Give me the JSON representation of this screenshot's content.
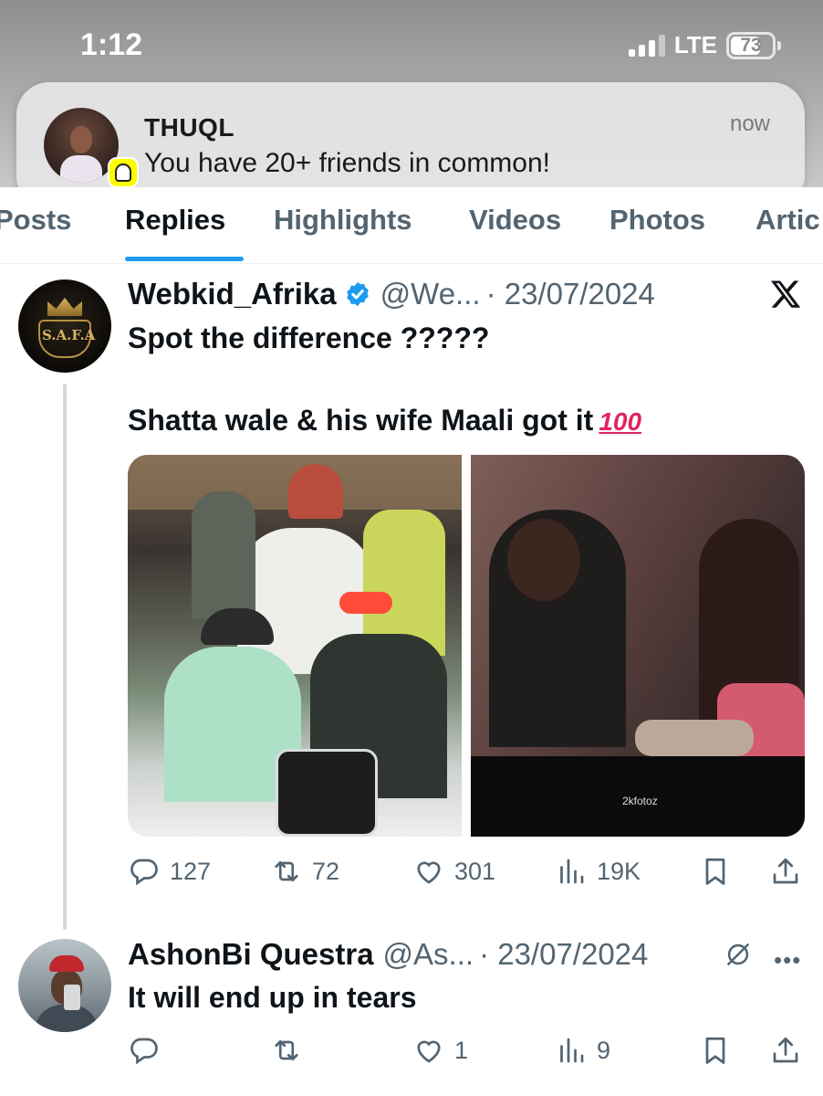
{
  "status_bar": {
    "time": "1:12",
    "network": "LTE",
    "battery_percent": "73",
    "battery_level": 0.73
  },
  "notification": {
    "app": "Snapchat",
    "title": "THUQL",
    "body": "You have 20+ friends in common!",
    "time": "now"
  },
  "tabs": [
    {
      "label": "Posts",
      "active": false
    },
    {
      "label": "Replies",
      "active": true
    },
    {
      "label": "Highlights",
      "active": false
    },
    {
      "label": "Videos",
      "active": false
    },
    {
      "label": "Photos",
      "active": false
    },
    {
      "label": "Artic",
      "active": false
    }
  ],
  "tweets": [
    {
      "name": "Webkid_Afrika",
      "verified": true,
      "handle": "@We...",
      "date": "· 23/07/2024",
      "avatar_text": "S.A.F.A",
      "text_line_1": "Spot the difference ?????",
      "text_line_2": "Shatta wale & his wife Maali got it",
      "emoji": "100",
      "photo_watermark": "2kfotoz",
      "stats": {
        "replies": "127",
        "reposts": "72",
        "likes": "301",
        "views": "19K"
      }
    },
    {
      "name": "AshonBi Questra",
      "handle": "@As...",
      "date": "· 23/07/2024",
      "text": "It will end up in tears",
      "stats": {
        "replies": "",
        "reposts": "",
        "likes": "1",
        "views": "9"
      }
    }
  ],
  "colors": {
    "accent": "#1d9bf0",
    "text_primary": "#0f1419",
    "text_secondary": "#536471",
    "verified": "#1d9bf0",
    "snapchat_yellow": "#fffc00"
  }
}
